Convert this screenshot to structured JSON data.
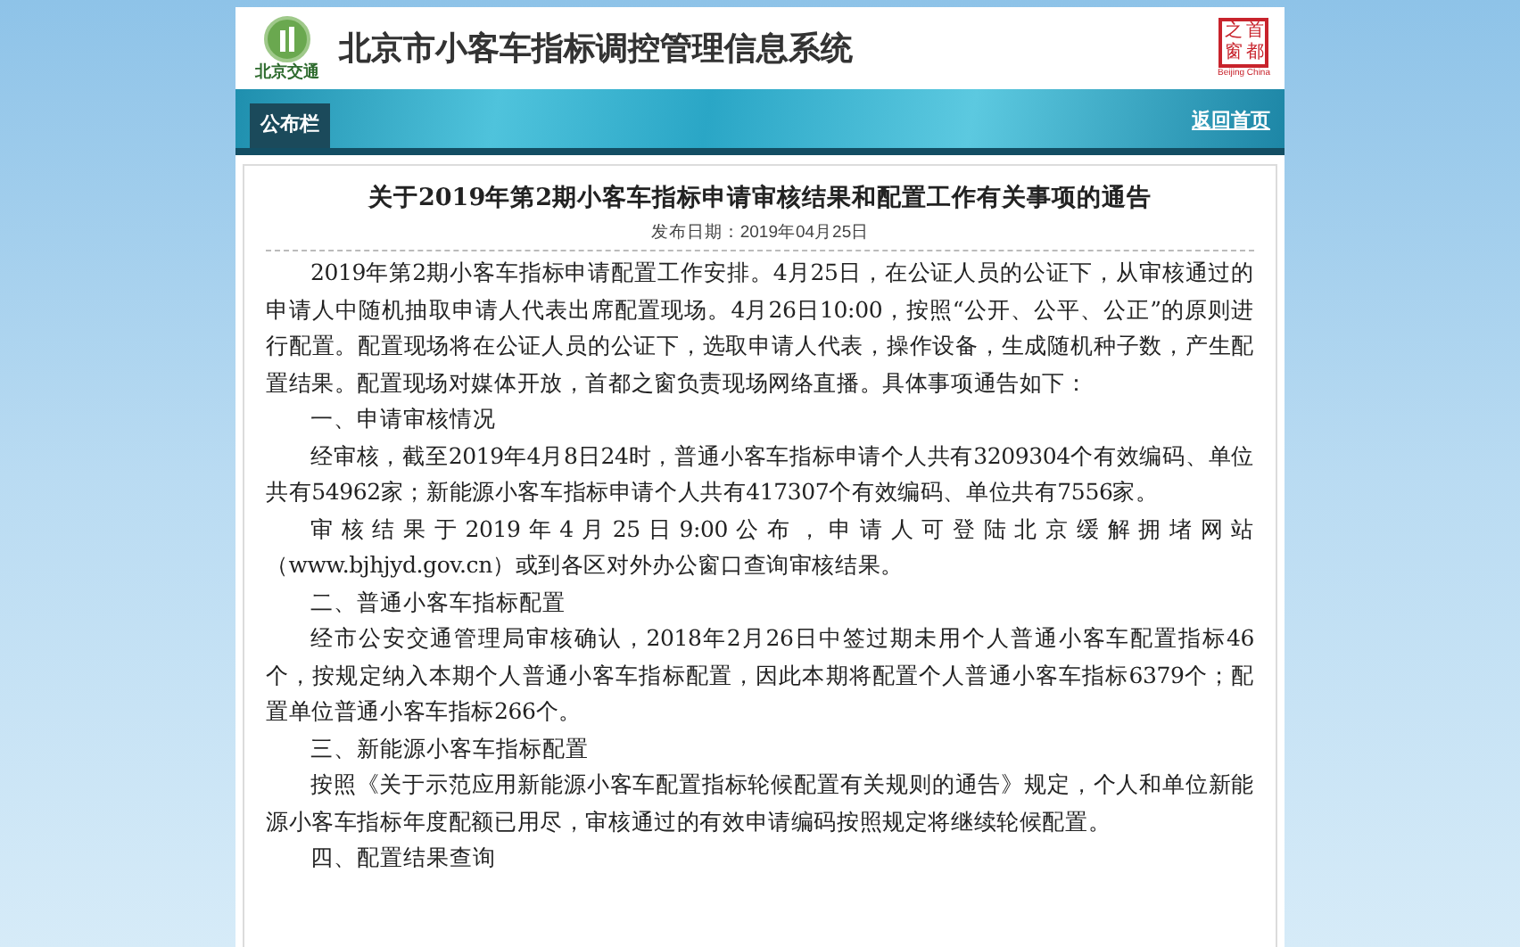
{
  "header": {
    "logo_caption": "北京交通",
    "title": "北京市小客车指标调控管理信息系统",
    "seal_chars": [
      "之",
      "首",
      "窗",
      "都"
    ],
    "seal_caption": "Beijing China"
  },
  "nav": {
    "tab": "公布栏",
    "home_link": "返回首页"
  },
  "notice": {
    "title": "关于2019年第2期小客车指标申请审核结果和配置工作有关事项的通告",
    "date": "发布日期：2019年04月25日",
    "blocks": [
      {
        "kind": "paragraph",
        "text": "2019年第2期小客车指标申请配置工作安排。4月25日，在公证人员的公证下，从审核通过的申请人中随机抽取申请人代表出席配置现场。4月26日10:00，按照“公开、公平、公正”的原则进行配置。配置现场将在公证人员的公证下，选取申请人代表，操作设备，生成随机种子数，产生配置结果。配置现场对媒体开放，首都之窗负责现场网络直播。具体事项通告如下："
      },
      {
        "kind": "heading",
        "text": "一、申请审核情况"
      },
      {
        "kind": "paragraph",
        "text": "经审核，截至2019年4月8日24时，普通小客车指标申请个人共有3209304个有效编码、单位共有54962家；新能源小客车指标申请个人共有417307个有效编码、单位共有7556家。"
      },
      {
        "kind": "paragraph",
        "text": "审核结果于2019年4月25日9:00公布，申请人可登陆北京缓解拥堵网站（www.bjhjyd.gov.cn）或到各区对外办公窗口查询审核结果。"
      },
      {
        "kind": "heading",
        "text": "二、普通小客车指标配置"
      },
      {
        "kind": "paragraph",
        "text": "经市公安交通管理局审核确认，2018年2月26日中签过期未用个人普通小客车配置指标46个，按规定纳入本期个人普通小客车指标配置，因此本期将配置个人普通小客车指标6379个；配置单位普通小客车指标266个。"
      },
      {
        "kind": "heading",
        "text": "三、新能源小客车指标配置"
      },
      {
        "kind": "paragraph",
        "text": "按照《关于示范应用新能源小客车配置指标轮候配置有关规则的通告》规定，个人和单位新能源小客车指标年度配额已用尽，审核通过的有效申请编码按照规定将继续轮候配置。"
      },
      {
        "kind": "heading",
        "text": "四、配置结果查询"
      }
    ]
  }
}
